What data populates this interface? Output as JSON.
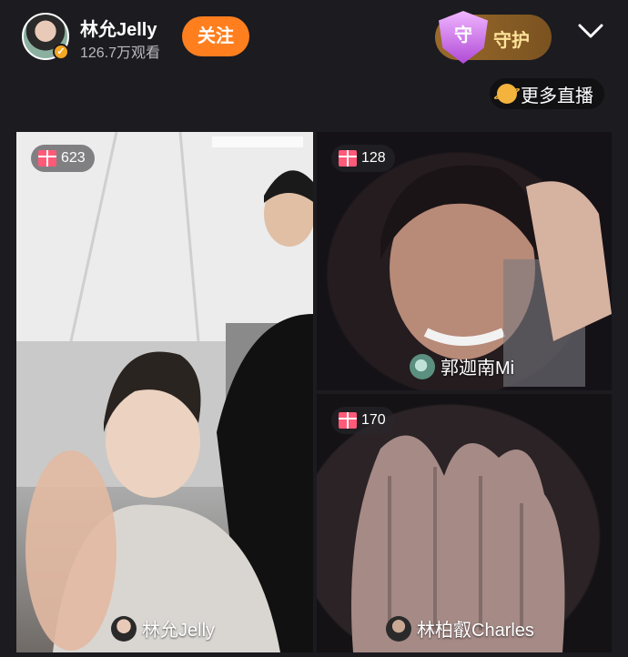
{
  "header": {
    "host_name": "林允Jelly",
    "viewers": "126.7万观看",
    "follow_label": "关注",
    "guard_badge_char": "守",
    "guard_label": "守护"
  },
  "more_live": {
    "label": "更多直播"
  },
  "panels": [
    {
      "gift_count": "623",
      "name": "林允Jelly"
    },
    {
      "gift_count": "128",
      "name": "郭迦南Mi"
    },
    {
      "gift_count": "170",
      "name": "林柏叡Charles"
    }
  ],
  "colors": {
    "follow": "#ff7f1e",
    "gift": "#ff5a78",
    "background": "#1b1b20"
  }
}
